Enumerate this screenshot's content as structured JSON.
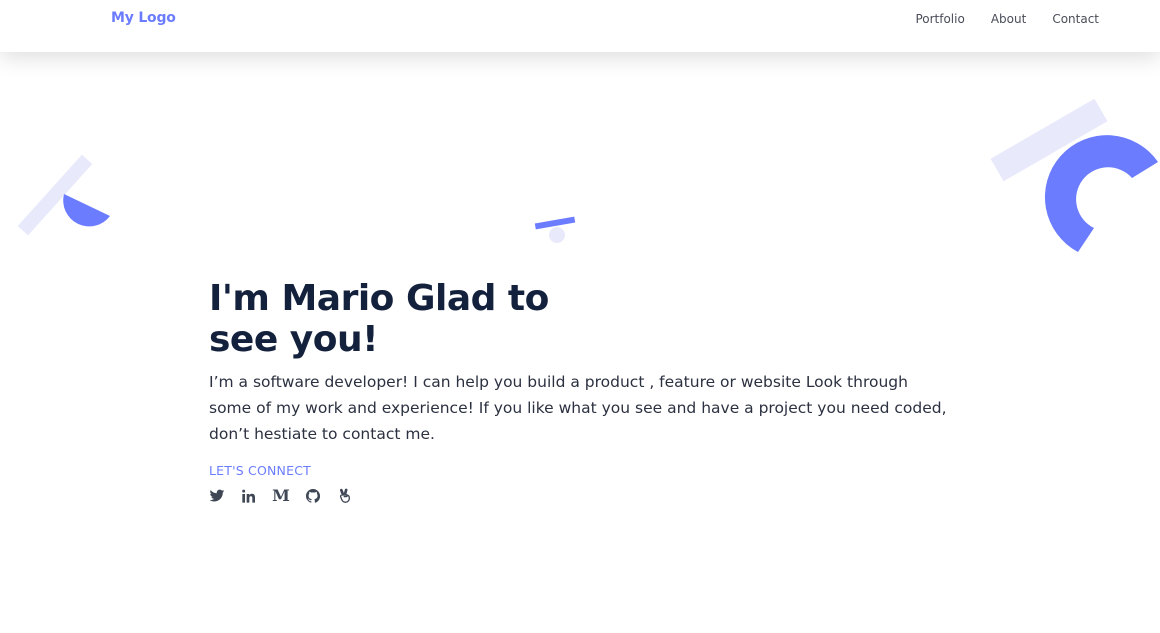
{
  "nav": {
    "logo": "My Logo",
    "links": [
      "Portfolio",
      "About",
      "Contact"
    ]
  },
  "hero": {
    "title": "I'm Mario Glad to see you!",
    "description": "I’m a software developer! I can help you build a product , feature or website Look through some of my work and experience! If you like what you see and have a project you need coded, don’t hestiate to contact me.",
    "connect_label": "LET'S CONNECT"
  },
  "socials": {
    "icons": [
      "twitter-icon",
      "linkedin-icon",
      "medium-icon",
      "github-icon",
      "angellist-icon"
    ],
    "medium_glyph": "M"
  },
  "colors": {
    "accent": "#6b7cff",
    "accent_light": "#e8eafc",
    "heading": "#14213d",
    "text": "#2b3140"
  }
}
